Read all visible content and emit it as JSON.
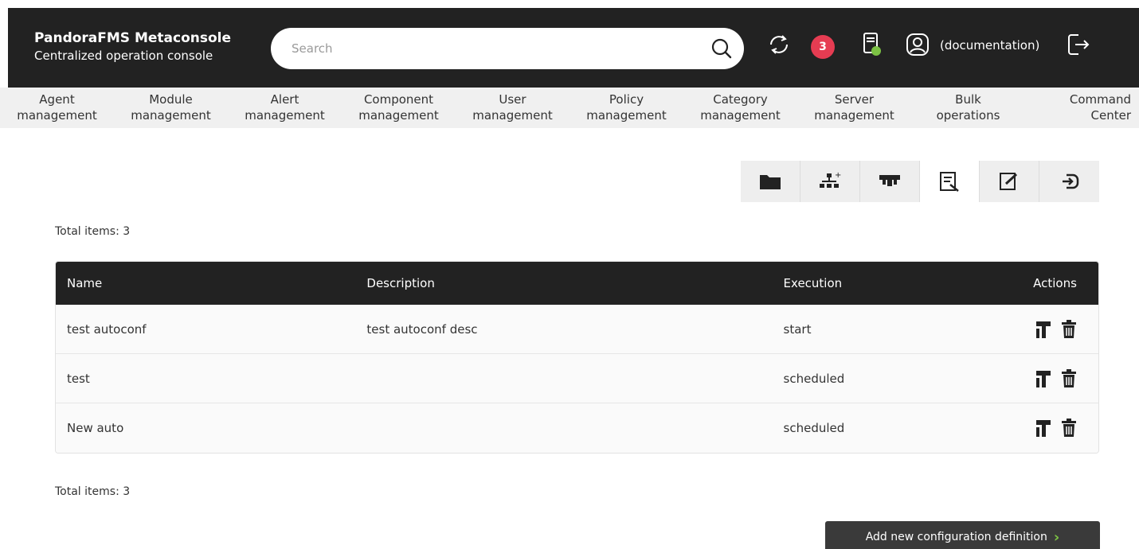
{
  "header": {
    "title": "PandoraFMS Metaconsole",
    "subtitle": "Centralized operation console",
    "search_placeholder": "Search",
    "notification_count": "3",
    "username": "(documentation)"
  },
  "nav": [
    {
      "line1": "Agent",
      "line2": "management"
    },
    {
      "line1": "Module",
      "line2": "management"
    },
    {
      "line1": "Alert",
      "line2": "management"
    },
    {
      "line1": "Component",
      "line2": "management"
    },
    {
      "line1": "User",
      "line2": "management"
    },
    {
      "line1": "Policy",
      "line2": "management"
    },
    {
      "line1": "Category",
      "line2": "management"
    },
    {
      "line1": "Server",
      "line2": "management"
    },
    {
      "line1": "Bulk",
      "line2": "operations"
    },
    {
      "line1": "Command",
      "line2": "Center"
    }
  ],
  "toolbar": {
    "icons": [
      "folder-icon",
      "hierarchy-add-icon",
      "network-icon",
      "config-list-icon",
      "edit-icon",
      "logout-box-icon"
    ],
    "active_index": 3
  },
  "total_top": "Total items: 3",
  "total_bottom": "Total items: 3",
  "table": {
    "headers": {
      "name": "Name",
      "description": "Description",
      "execution": "Execution",
      "actions": "Actions"
    },
    "rows": [
      {
        "name": "test autoconf",
        "description": "test autoconf desc",
        "execution": "start"
      },
      {
        "name": "test",
        "description": "",
        "execution": "scheduled"
      },
      {
        "name": "New auto",
        "description": "",
        "execution": "scheduled"
      }
    ]
  },
  "add_button": "Add new configuration definition",
  "colors": {
    "header_bg": "#222222",
    "accent_green": "#7cc244",
    "badge_red": "#e63c52"
  }
}
